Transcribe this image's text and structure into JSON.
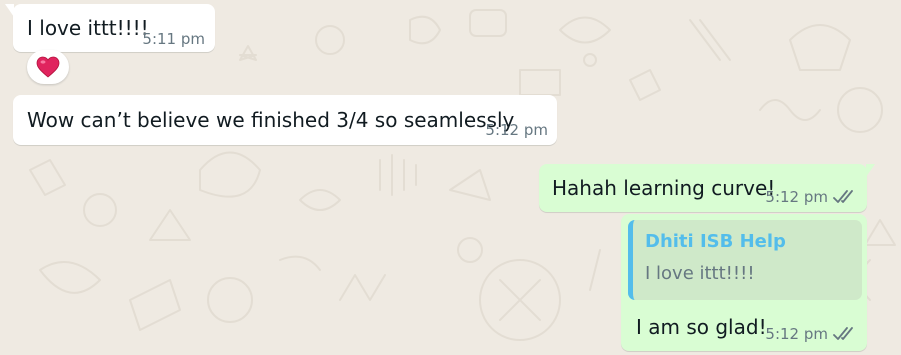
{
  "chat": {
    "messages": [
      {
        "direction": "incoming",
        "text": "I love ittt!!!!",
        "time": "5:11 pm",
        "reaction": "❤️"
      },
      {
        "direction": "incoming",
        "text": "Wow can’t believe we finished 3/4 so seamlessly",
        "time": "5:12 pm"
      },
      {
        "direction": "outgoing",
        "text": "Hahah learning curve!",
        "time": "5:12 pm",
        "status": "read"
      },
      {
        "direction": "outgoing",
        "quoted": {
          "author": "Dhiti ISB Help",
          "text": "I love ittt!!!!"
        },
        "text": "I am so glad!",
        "time": "5:12 pm",
        "status": "read"
      }
    ]
  },
  "colors": {
    "wallpaper": "#efeae2",
    "incoming_bubble": "#ffffff",
    "outgoing_bubble": "#d9fdd3",
    "quote_accent": "#53bdeb",
    "meta_text": "#667781",
    "read_ticks": "#667781"
  },
  "icons": {
    "read_receipt": "double-check-icon",
    "reaction": "red-heart-icon"
  }
}
